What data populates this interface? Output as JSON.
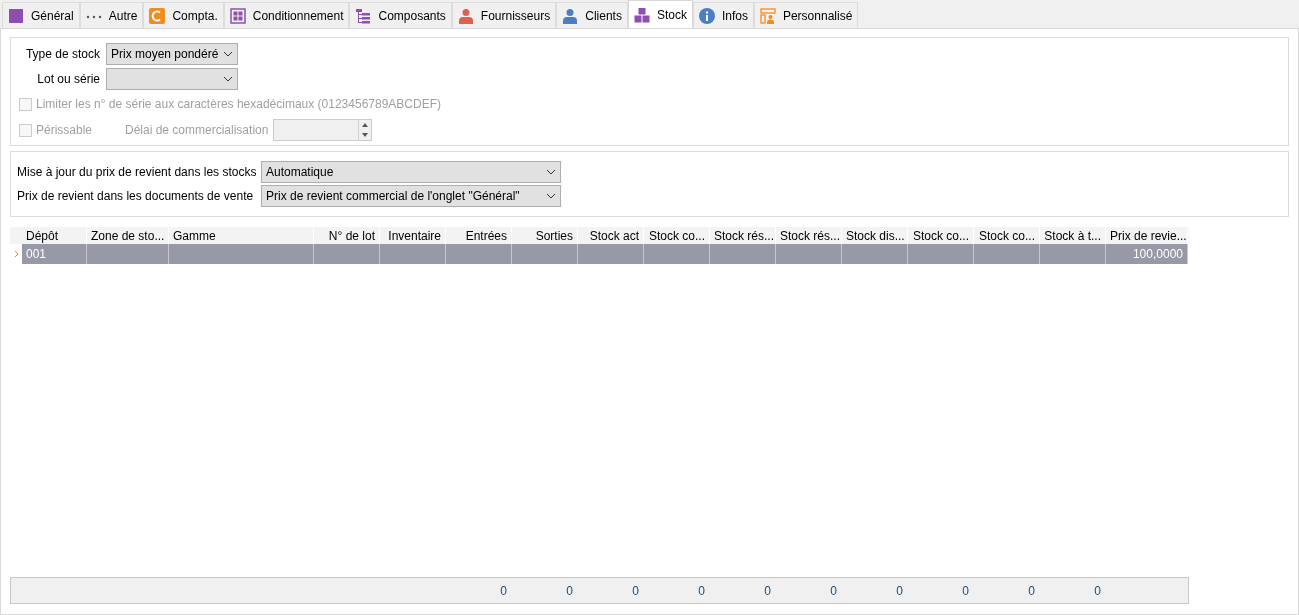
{
  "tabs": [
    {
      "label": "Général",
      "kind": "square",
      "selected": false
    },
    {
      "label": "Autre",
      "kind": "dots",
      "selected": false
    },
    {
      "label": "Compta.",
      "kind": "compta",
      "selected": false
    },
    {
      "label": "Conditionnement",
      "kind": "grid",
      "selected": false
    },
    {
      "label": "Composants",
      "kind": "tree",
      "selected": false
    },
    {
      "label": "Fournisseurs",
      "kind": "supplier",
      "selected": false
    },
    {
      "label": "Clients",
      "kind": "client",
      "selected": false
    },
    {
      "label": "Stock",
      "kind": "blocks",
      "selected": true
    },
    {
      "label": "Infos",
      "kind": "info",
      "selected": false
    },
    {
      "label": "Personnalisé",
      "kind": "custom",
      "selected": false
    }
  ],
  "stock_group": {
    "type_de_stock": {
      "label": "Type de stock",
      "value": "Prix moyen pondéré"
    },
    "lot_ou_serie": {
      "label": "Lot ou série"
    },
    "hexa_checkbox": {
      "label": "Limiter les n° de série aux caractères hexadécimaux (0123456789ABCDEF)",
      "checked": false,
      "disabled": true
    },
    "perissable_checkbox": {
      "label": "Périssable",
      "checked": false,
      "disabled": true
    },
    "delai": {
      "label": "Délai de commercialisation",
      "disabled": true
    }
  },
  "cost_group": {
    "mise_a_jour": {
      "label": "Mise à jour du prix de revient dans les stocks",
      "value": "Automatique"
    },
    "prix_documents": {
      "label": "Prix de revient dans les documents de vente",
      "value": "Prix de revient commercial de l'onglet \"Général\""
    }
  },
  "table": {
    "columns": [
      {
        "label": "Dépôt",
        "kind": "text"
      },
      {
        "label": "Zone de sto...",
        "kind": "text"
      },
      {
        "label": "Gamme",
        "kind": "text"
      },
      {
        "label": "N° de lot",
        "kind": "number"
      },
      {
        "label": "Inventaire",
        "kind": "number"
      },
      {
        "label": "Entrées",
        "kind": "number",
        "total": "0"
      },
      {
        "label": "Sorties",
        "kind": "number",
        "total": "0"
      },
      {
        "label": "Stock act",
        "kind": "number",
        "total": "0"
      },
      {
        "label": "Stock co...",
        "kind": "number",
        "total": "0"
      },
      {
        "label": "Stock rés...",
        "kind": "number",
        "total": "0"
      },
      {
        "label": "Stock rés...",
        "kind": "number",
        "total": "0"
      },
      {
        "label": "Stock dis...",
        "kind": "number",
        "total": "0"
      },
      {
        "label": "Stock co...",
        "kind": "number",
        "total": "0"
      },
      {
        "label": "Stock co...",
        "kind": "number",
        "total": "0"
      },
      {
        "label": "Stock à t...",
        "kind": "number",
        "total": "0"
      },
      {
        "label": "Prix de revie...",
        "kind": "number"
      }
    ],
    "rows": [
      {
        "selected": true,
        "cells": {
          "0": "001",
          "15": "100,0000"
        }
      }
    ]
  }
}
